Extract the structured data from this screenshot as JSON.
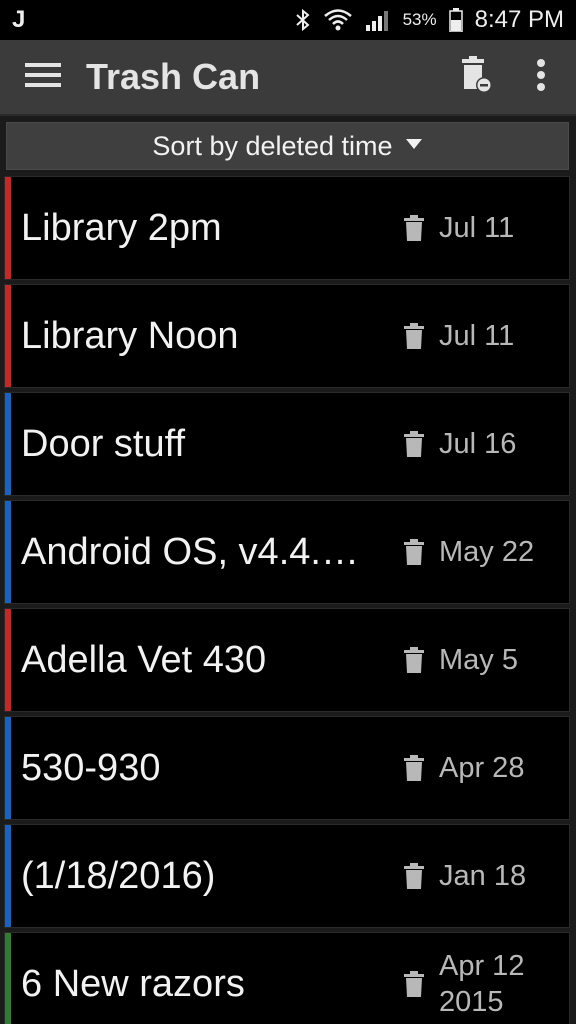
{
  "status_bar": {
    "left_icon": "J",
    "bluetooth_icon": "bluetooth-icon",
    "wifi_icon": "wifi-icon",
    "signal_icon": "signal-icon",
    "battery_percent": "53%",
    "battery_icon": "battery-icon",
    "time": "8:47 PM"
  },
  "app_bar": {
    "title": "Trash Can",
    "menu_icon": "hamburger-menu-icon",
    "empty_trash_icon": "trash-remove-icon",
    "overflow_icon": "more-vert-icon"
  },
  "sort": {
    "label": "Sort by deleted time",
    "dropdown_icon": "triangle-down-icon"
  },
  "colors": {
    "red": "#c62828",
    "blue": "#1565c0",
    "green": "#2e7d32"
  },
  "items": [
    {
      "title": "Library 2pm",
      "date": "Jul 11",
      "color": "#c62828"
    },
    {
      "title": "Library Noon",
      "date": "Jul 11",
      "color": "#c62828"
    },
    {
      "title": "Door stuff",
      "date": "Jul 16",
      "color": "#1565c0"
    },
    {
      "title": "Android OS, v4.4.4…",
      "date": "May 22",
      "color": "#1565c0"
    },
    {
      "title": "Adella Vet 430",
      "date": "May 5",
      "color": "#c62828"
    },
    {
      "title": "530-930",
      "date": "Apr 28",
      "color": "#1565c0"
    },
    {
      "title": "(1/18/2016)",
      "date": "Jan 18",
      "color": "#1565c0"
    },
    {
      "title": "6 New razors",
      "date": "Apr 12\n2015",
      "color": "#2e7d32"
    }
  ]
}
